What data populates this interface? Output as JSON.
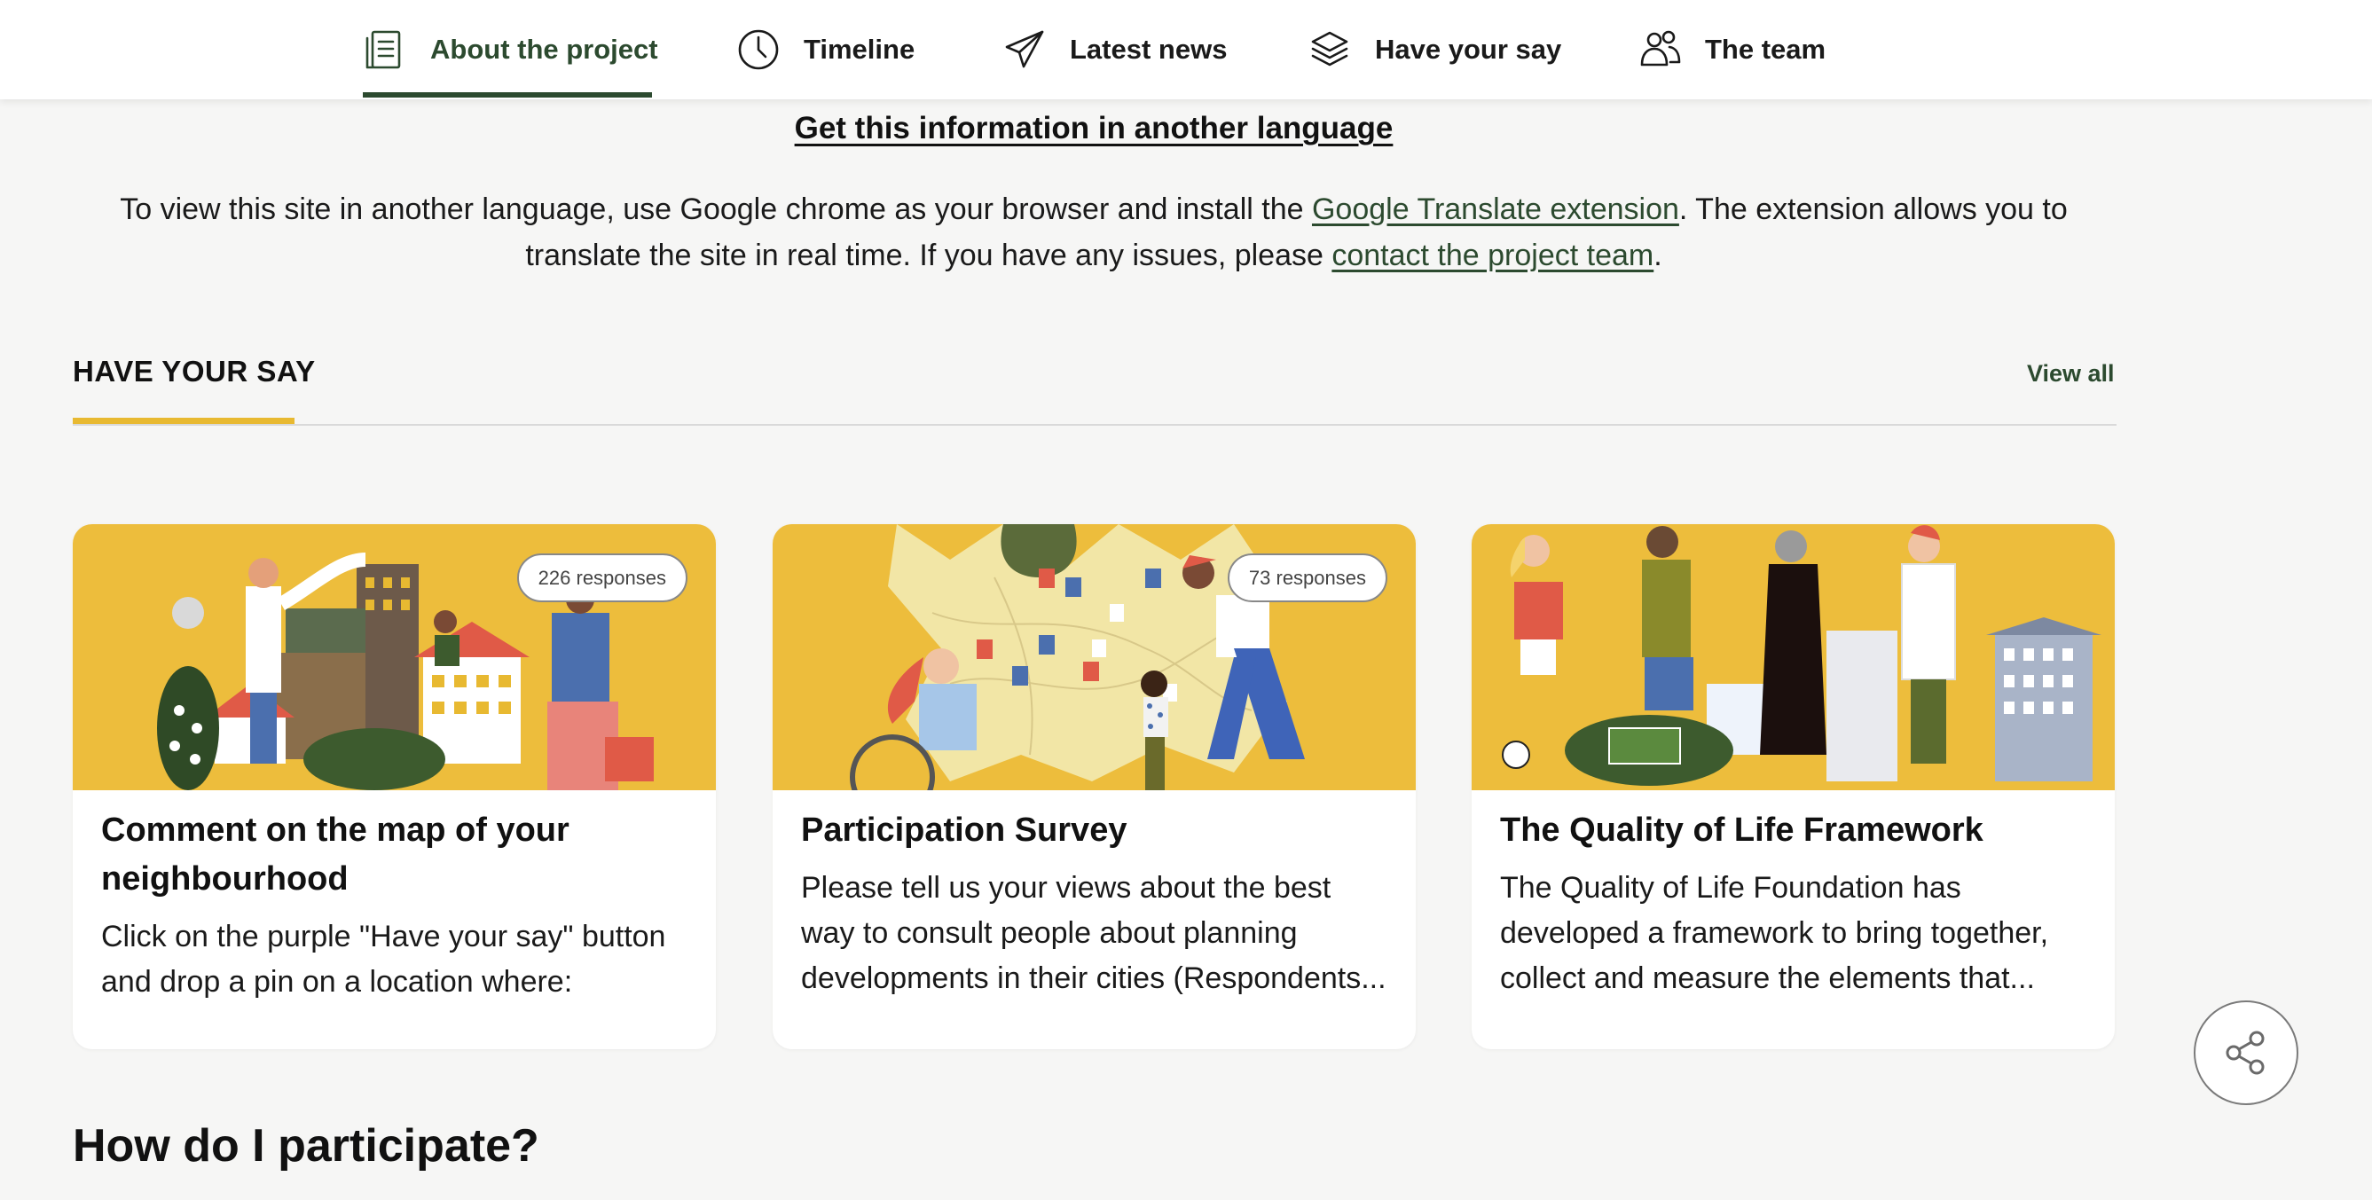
{
  "nav": {
    "items": [
      {
        "label": "About the project",
        "icon": "document-icon",
        "active": true
      },
      {
        "label": "Timeline",
        "icon": "clock-icon",
        "active": false
      },
      {
        "label": "Latest news",
        "icon": "paper-plane-icon",
        "active": false
      },
      {
        "label": "Have your say",
        "icon": "layers-icon",
        "active": false
      },
      {
        "label": "The team",
        "icon": "people-icon",
        "active": false
      }
    ]
  },
  "language": {
    "title": "Get this information in another language",
    "text_1": "To view this site in another language, use Google chrome as your browser and install the ",
    "link_1": "Google Translate extension",
    "text_2": ". The extension allows you to translate the site in real time. If you have any issues, please ",
    "link_2": "contact the project team",
    "text_3": "."
  },
  "have_your_say": {
    "title": "HAVE YOUR SAY",
    "view_all": "View all",
    "cards": [
      {
        "badge": "226 responses",
        "title": "Comment on the map of your neighbourhood",
        "description": "Click on the purple \"Have your say\" button and drop a pin on a location where:"
      },
      {
        "badge": "73 responses",
        "title": "Participation Survey",
        "description": "Please tell us your views about the best way to consult people about planning developments in their cities (Respondents..."
      },
      {
        "badge": "",
        "title": "The Quality of Life Framework",
        "description": "The Quality of Life Foundation has developed a framework to bring together, collect and measure the elements that..."
      }
    ]
  },
  "participate": {
    "title": "How do I participate?"
  },
  "share": {
    "icon": "share-icon"
  },
  "colors": {
    "accent_green": "#2c4a2f",
    "accent_yellow": "#e8b931",
    "card_art_bg": "#edbd3c"
  }
}
